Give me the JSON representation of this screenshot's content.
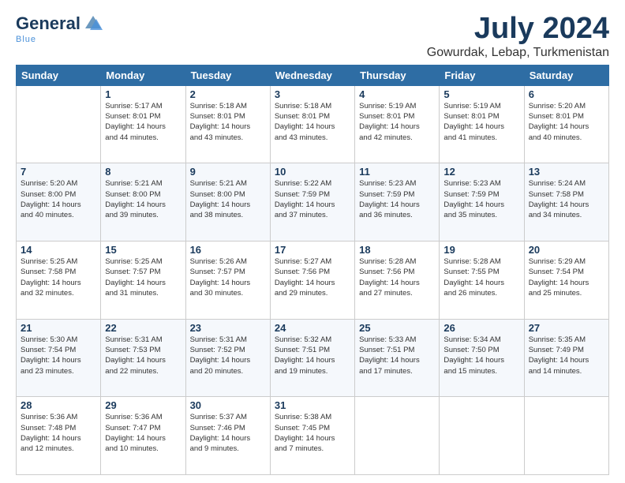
{
  "logo": {
    "line1": "General",
    "line2": "Blue"
  },
  "title": "July 2024",
  "subtitle": "Gowurdak, Lebap, Turkmenistan",
  "weekdays": [
    "Sunday",
    "Monday",
    "Tuesday",
    "Wednesday",
    "Thursday",
    "Friday",
    "Saturday"
  ],
  "weeks": [
    [
      {
        "day": "",
        "info": ""
      },
      {
        "day": "1",
        "info": "Sunrise: 5:17 AM\nSunset: 8:01 PM\nDaylight: 14 hours\nand 44 minutes."
      },
      {
        "day": "2",
        "info": "Sunrise: 5:18 AM\nSunset: 8:01 PM\nDaylight: 14 hours\nand 43 minutes."
      },
      {
        "day": "3",
        "info": "Sunrise: 5:18 AM\nSunset: 8:01 PM\nDaylight: 14 hours\nand 43 minutes."
      },
      {
        "day": "4",
        "info": "Sunrise: 5:19 AM\nSunset: 8:01 PM\nDaylight: 14 hours\nand 42 minutes."
      },
      {
        "day": "5",
        "info": "Sunrise: 5:19 AM\nSunset: 8:01 PM\nDaylight: 14 hours\nand 41 minutes."
      },
      {
        "day": "6",
        "info": "Sunrise: 5:20 AM\nSunset: 8:01 PM\nDaylight: 14 hours\nand 40 minutes."
      }
    ],
    [
      {
        "day": "7",
        "info": "Sunrise: 5:20 AM\nSunset: 8:00 PM\nDaylight: 14 hours\nand 40 minutes."
      },
      {
        "day": "8",
        "info": "Sunrise: 5:21 AM\nSunset: 8:00 PM\nDaylight: 14 hours\nand 39 minutes."
      },
      {
        "day": "9",
        "info": "Sunrise: 5:21 AM\nSunset: 8:00 PM\nDaylight: 14 hours\nand 38 minutes."
      },
      {
        "day": "10",
        "info": "Sunrise: 5:22 AM\nSunset: 7:59 PM\nDaylight: 14 hours\nand 37 minutes."
      },
      {
        "day": "11",
        "info": "Sunrise: 5:23 AM\nSunset: 7:59 PM\nDaylight: 14 hours\nand 36 minutes."
      },
      {
        "day": "12",
        "info": "Sunrise: 5:23 AM\nSunset: 7:59 PM\nDaylight: 14 hours\nand 35 minutes."
      },
      {
        "day": "13",
        "info": "Sunrise: 5:24 AM\nSunset: 7:58 PM\nDaylight: 14 hours\nand 34 minutes."
      }
    ],
    [
      {
        "day": "14",
        "info": "Sunrise: 5:25 AM\nSunset: 7:58 PM\nDaylight: 14 hours\nand 32 minutes."
      },
      {
        "day": "15",
        "info": "Sunrise: 5:25 AM\nSunset: 7:57 PM\nDaylight: 14 hours\nand 31 minutes."
      },
      {
        "day": "16",
        "info": "Sunrise: 5:26 AM\nSunset: 7:57 PM\nDaylight: 14 hours\nand 30 minutes."
      },
      {
        "day": "17",
        "info": "Sunrise: 5:27 AM\nSunset: 7:56 PM\nDaylight: 14 hours\nand 29 minutes."
      },
      {
        "day": "18",
        "info": "Sunrise: 5:28 AM\nSunset: 7:56 PM\nDaylight: 14 hours\nand 27 minutes."
      },
      {
        "day": "19",
        "info": "Sunrise: 5:28 AM\nSunset: 7:55 PM\nDaylight: 14 hours\nand 26 minutes."
      },
      {
        "day": "20",
        "info": "Sunrise: 5:29 AM\nSunset: 7:54 PM\nDaylight: 14 hours\nand 25 minutes."
      }
    ],
    [
      {
        "day": "21",
        "info": "Sunrise: 5:30 AM\nSunset: 7:54 PM\nDaylight: 14 hours\nand 23 minutes."
      },
      {
        "day": "22",
        "info": "Sunrise: 5:31 AM\nSunset: 7:53 PM\nDaylight: 14 hours\nand 22 minutes."
      },
      {
        "day": "23",
        "info": "Sunrise: 5:31 AM\nSunset: 7:52 PM\nDaylight: 14 hours\nand 20 minutes."
      },
      {
        "day": "24",
        "info": "Sunrise: 5:32 AM\nSunset: 7:51 PM\nDaylight: 14 hours\nand 19 minutes."
      },
      {
        "day": "25",
        "info": "Sunrise: 5:33 AM\nSunset: 7:51 PM\nDaylight: 14 hours\nand 17 minutes."
      },
      {
        "day": "26",
        "info": "Sunrise: 5:34 AM\nSunset: 7:50 PM\nDaylight: 14 hours\nand 15 minutes."
      },
      {
        "day": "27",
        "info": "Sunrise: 5:35 AM\nSunset: 7:49 PM\nDaylight: 14 hours\nand 14 minutes."
      }
    ],
    [
      {
        "day": "28",
        "info": "Sunrise: 5:36 AM\nSunset: 7:48 PM\nDaylight: 14 hours\nand 12 minutes."
      },
      {
        "day": "29",
        "info": "Sunrise: 5:36 AM\nSunset: 7:47 PM\nDaylight: 14 hours\nand 10 minutes."
      },
      {
        "day": "30",
        "info": "Sunrise: 5:37 AM\nSunset: 7:46 PM\nDaylight: 14 hours\nand 9 minutes."
      },
      {
        "day": "31",
        "info": "Sunrise: 5:38 AM\nSunset: 7:45 PM\nDaylight: 14 hours\nand 7 minutes."
      },
      {
        "day": "",
        "info": ""
      },
      {
        "day": "",
        "info": ""
      },
      {
        "day": "",
        "info": ""
      }
    ]
  ]
}
